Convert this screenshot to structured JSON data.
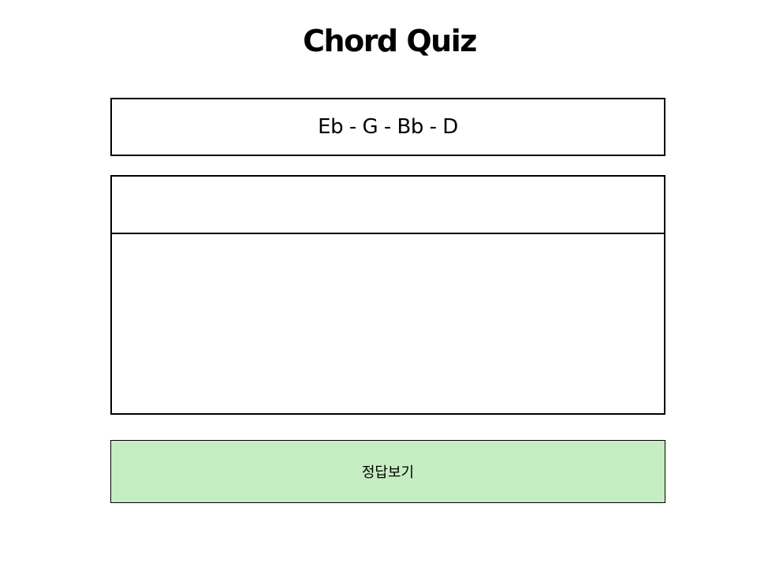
{
  "header": {
    "title": "Chord Quiz"
  },
  "quiz": {
    "question": "Eb - G - Bb - D",
    "answer_name": "",
    "answer_detail": ""
  },
  "actions": {
    "show_answer_label": "정답보기",
    "button_color": "#c6edc1"
  }
}
